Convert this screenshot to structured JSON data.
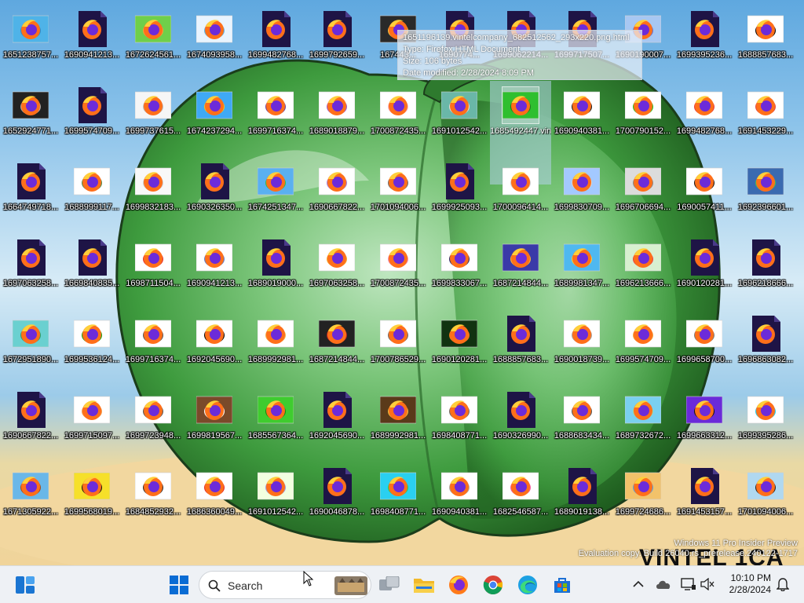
{
  "tooltip": {
    "name": "1651196139.vintelcompany_682512562_293x220.png.html",
    "type": "Type: Firefox HTML Document",
    "size": "Size: 106 bytes",
    "date": "Date modified: 2/28/2024 8:09 PM"
  },
  "desktop": {
    "selected_name": "1685492447.vintelcompany_untitled4_20230530211615.png",
    "files": [
      [
        "1651238757...",
        "1690941213...",
        "1672624561...",
        "1674093958...",
        "1699482768...",
        "1699792659...",
        "167443...",
        "1690774...",
        "1699062214...",
        "1699717507...",
        "1690190007...",
        "1699395236...",
        "1688857683..."
      ],
      [
        "1652924771...",
        "1699574709...",
        "1699737615...",
        "1674237294...",
        "1699716374...",
        "1689018879...",
        "1700872435...",
        "1691012542...",
        "1685492447.vintelcompany_untitled4_20230530211615.png",
        "1690940381...",
        "1700790152...",
        "1699482768...",
        "1691453229..."
      ],
      [
        "1664749718...",
        "1688999117...",
        "1699832183...",
        "1690326350...",
        "1674251347...",
        "1690667822...",
        "1701094006...",
        "1699925093...",
        "1700096414...",
        "1699830709...",
        "1696706694...",
        "1690057411...",
        "1692396601..."
      ],
      [
        "1697063258...",
        "1669840835...",
        "1698711504...",
        "1690941213...",
        "1689019000...",
        "1697063258...",
        "1700872435...",
        "1699833067...",
        "1687214844...",
        "1689981347...",
        "1696213666...",
        "1690120281...",
        "1696218666..."
      ],
      [
        "1672951890...",
        "1699536124...",
        "1699716374...",
        "1692045690...",
        "1689992981...",
        "1687214844...",
        "1700786529...",
        "1690120281...",
        "1688857683...",
        "1690018739...",
        "1699574709...",
        "1699658700...",
        "1696863082..."
      ],
      [
        "1690667822...",
        "1699715097...",
        "1699723948...",
        "1699819567...",
        "1685567364...",
        "1692045690...",
        "1689992981...",
        "1698408771...",
        "1690326990...",
        "1688683434...",
        "1689732672...",
        "1699663312...",
        "1699395286..."
      ],
      [
        "1671305922...",
        "1699568019...",
        "1684852932...",
        "1686360049...",
        "1691012542...",
        "1690046878...",
        "1698408771...",
        "1690940381...",
        "1682546587...",
        "1689019138...",
        "1699724686...",
        "1691453157...",
        "1701094006..."
      ]
    ]
  },
  "watermark": {
    "line1": "Windows 11 Pro Insider Preview",
    "line2": "Evaluation copy. Build 26040.rs_prerelease.240122-1717",
    "big": "VINTEL 1CA"
  },
  "taskbar": {
    "search_label": "Search",
    "time": "10:10 PM",
    "date": "2/28/2024",
    "icons": [
      "widgets-icon",
      "start-icon",
      "task-view-icon",
      "file-explorer-icon",
      "firefox-icon",
      "chrome-icon",
      "edge-icon",
      "store-icon"
    ]
  },
  "colors": {
    "taskbar_bg": "#eef1f5",
    "firefox_sheet": "#1e1446",
    "apple_green": "#3fa33f",
    "start_blue": "#0a6cd4"
  }
}
